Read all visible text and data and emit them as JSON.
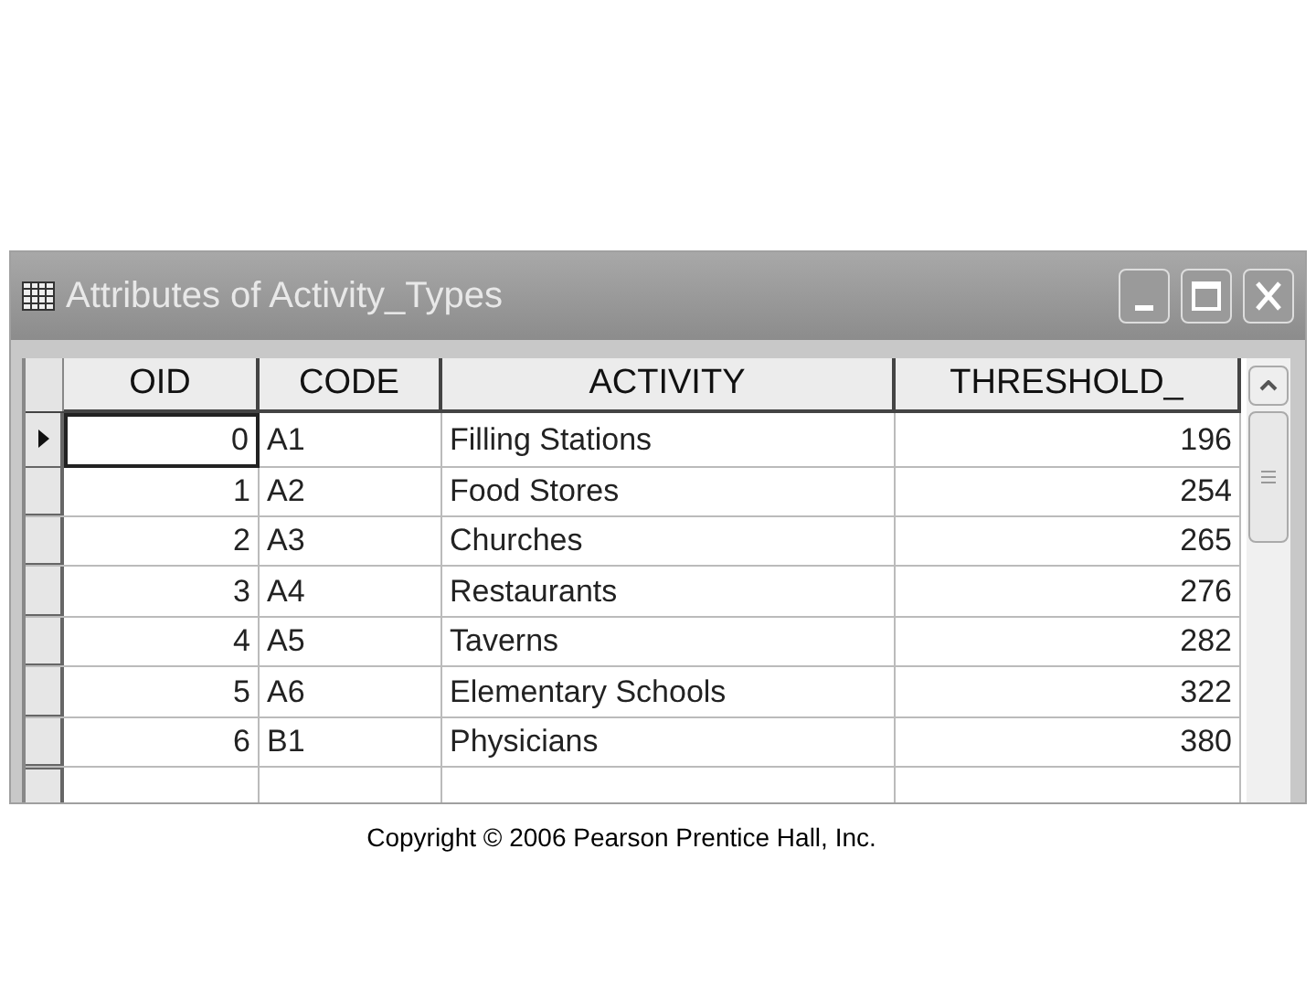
{
  "window": {
    "title": "Attributes of Activity_Types"
  },
  "table": {
    "columns": [
      "OID",
      "CODE",
      "ACTIVITY",
      "THRESHOLD_"
    ],
    "rows": [
      {
        "cells": [
          "0",
          "A1",
          "Filling Stations",
          "196"
        ],
        "selected": true
      },
      {
        "cells": [
          "1",
          "A2",
          "Food Stores",
          "254"
        ],
        "selected": false
      },
      {
        "cells": [
          "2",
          "A3",
          "Churches",
          "265"
        ],
        "selected": false
      },
      {
        "cells": [
          "3",
          "A4",
          "Restaurants",
          "276"
        ],
        "selected": false
      },
      {
        "cells": [
          "4",
          "A5",
          "Taverns",
          "282"
        ],
        "selected": false
      },
      {
        "cells": [
          "5",
          "A6",
          "Elementary Schools",
          "322"
        ],
        "selected": false
      },
      {
        "cells": [
          "6",
          "B1",
          "Physicians",
          "380"
        ],
        "selected": false
      }
    ]
  },
  "caption": "Copyright © 2006 Pearson Prentice Hall, Inc."
}
